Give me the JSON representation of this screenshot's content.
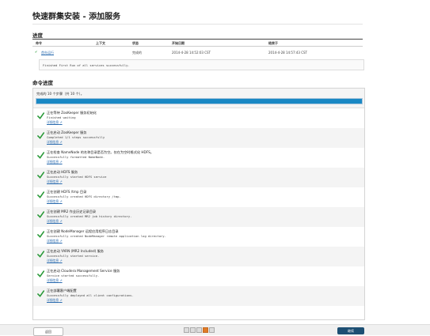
{
  "page_title": "快速群集安装 - 添加服务",
  "progress": {
    "heading": "进度",
    "columns": [
      "命令",
      "上下文",
      "状态",
      "开始日期",
      "结束于"
    ],
    "row": {
      "command": "首先运行",
      "context": "",
      "status": "完成的",
      "start": "2014-4-28 14:52:03 CST",
      "end": "2014-4-28 14:57:43 CST"
    },
    "message": "Finished First Run of all services successfully."
  },
  "command_progress": {
    "heading": "命令进度",
    "summary": "完成的 10 个步骤（共 10 个）。",
    "percent": 100,
    "details_label": "详细信息",
    "steps": [
      {
        "title": "正在等待 ZooKeeper 服务初始化",
        "message": "Finished waiting"
      },
      {
        "title": "正在启动 ZooKeeper 服务",
        "message": "Completed 1/1 steps successfully"
      },
      {
        "title": "正在检查 NameNode 的名称目录是否为空。仅在为空时格式化 HDFS。",
        "message": "Successfully formatted NameNode."
      },
      {
        "title": "正在启动 HDFS 服务",
        "message": "Successfully started HDFS service"
      },
      {
        "title": "正在创建 HDFS /tmp 目录",
        "message": "Successfully created HDFS directory /tmp."
      },
      {
        "title": "正在创建 MR2 作业历史记录目录",
        "message": "Successfully created MR2 job history directory."
      },
      {
        "title": "正在创建 NodeManager 远程应用程序日志目录",
        "message": "Successfully created NodeManager remote application log directory."
      },
      {
        "title": "正在启动 YARN (MR2 Included) 服务",
        "message": "Successfully started service."
      },
      {
        "title": "正在启动 Cloudera Management Service 服务",
        "message": "Service started successfully."
      },
      {
        "title": "正在部署客户端配置",
        "message": "Successfully deployed all client configurations."
      }
    ]
  },
  "footer": {
    "back_label": "返回",
    "next_label": "继续",
    "pager_count": 5,
    "pager_current": 4
  },
  "colors": {
    "accent": "#1a88c4",
    "check": "#2b9a3a",
    "link": "#2b6cb0",
    "primary_button": "#1d4f73"
  }
}
